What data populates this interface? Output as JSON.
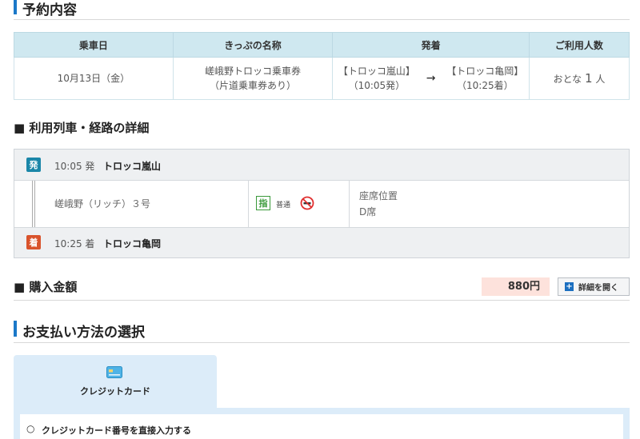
{
  "reservation": {
    "title": "予約内容",
    "headers": [
      "乗車日",
      "きっぷの名称",
      "発着",
      "ご利用人数"
    ],
    "date": "10月13日（金）",
    "ticket_name": "嵯峨野トロッコ乗車券",
    "ticket_sub": "（片道乗車券あり）",
    "from_station": "【トロッコ嵐山】",
    "from_time": "（10:05発）",
    "arrow": "→",
    "to_station": "【トロッコ亀岡】",
    "to_time": "（10:25着）",
    "people_prefix": "おとな",
    "people_count": "1",
    "people_suffix": "人"
  },
  "route": {
    "title": "■ 利用列車・経路の詳細",
    "departure": {
      "badge": "発",
      "time": "10:05 発",
      "station": "トロッコ嵐山"
    },
    "train": {
      "name": "嵯峨野（リッチ）３号",
      "reserved_badge": "指",
      "car_class": "普通",
      "seat_label": "座席位置",
      "seat_value": "D席"
    },
    "arrival": {
      "badge": "着",
      "time": "10:25 着",
      "station": "トロッコ亀岡"
    }
  },
  "purchase": {
    "title": "■ 購入金額",
    "amount": "880円",
    "detail_button": "詳細を開く"
  },
  "payment": {
    "title": "お支払い方法の選択",
    "tab_credit": "クレジットカード",
    "option_direct": "クレジットカード番号を直接入力する",
    "radio_mark": "○"
  },
  "colors": {
    "accent": "#1b78c8",
    "table_header": "#cfe8f0",
    "departure_badge": "#1a86a8",
    "arrival_badge": "#d9532c",
    "price_bg": "#fde2dc",
    "reserved_green": "#3a9a3a"
  },
  "icons": [
    "plus-icon",
    "credit-card-icon",
    "no-smoking-icon",
    "arrow-right-icon"
  ]
}
